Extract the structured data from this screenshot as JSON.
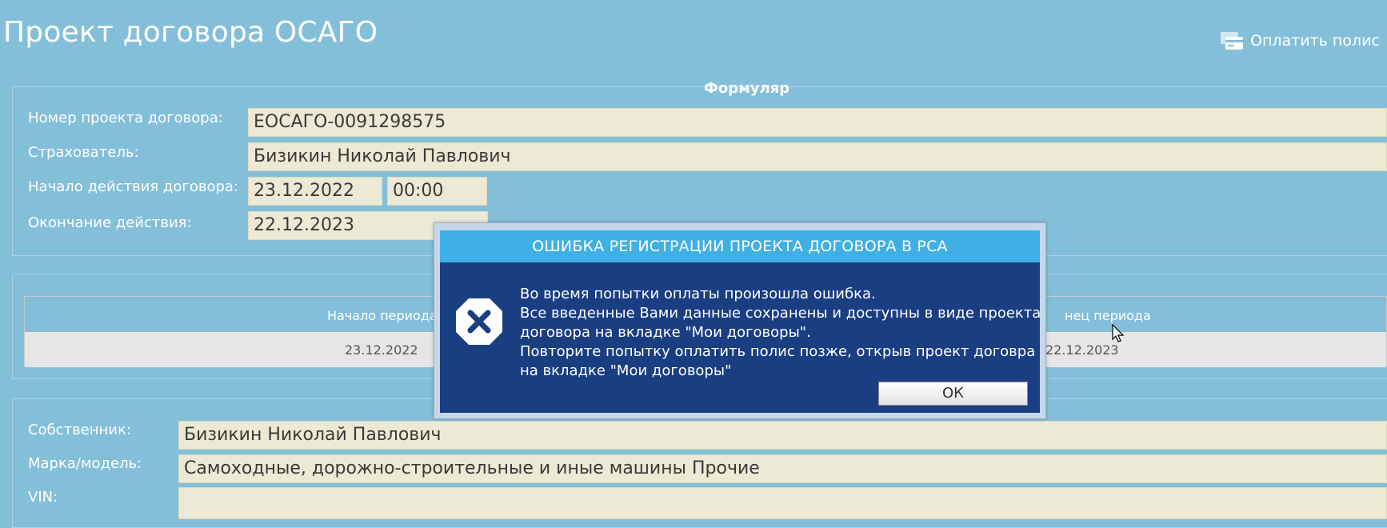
{
  "header": {
    "title": "Проект договора ОСАГО",
    "pay_link": "Оплатить полис"
  },
  "form": {
    "legend": "Формуляр",
    "contract_number_label": "Номер проекта договора:",
    "contract_number_value": "ЕОСАГО-0091298575",
    "insurer_label": "Страхователь:",
    "insurer_value": "Бизикин Николай Павлович",
    "start_label": "Начало действия договора:",
    "start_date": "23.12.2022",
    "start_time": "00:00",
    "end_label": "Окончание действия:",
    "end_date": "22.12.2023"
  },
  "periods": {
    "headers": [
      "Начало периода",
      "нец периода"
    ],
    "rows": [
      [
        "23.12.2022",
        "22.12.2023"
      ]
    ]
  },
  "vehicle": {
    "owner_label": "Собственник:",
    "owner_value": "Бизикин Николай Павлович",
    "model_label": "Марка/модель:",
    "model_value": "Самоходные, дорожно-строительные и иные машины Прочие",
    "vin_label": "VIN:",
    "vin_value": ""
  },
  "dialog": {
    "title": "ОШИБКА РЕГИСТРАЦИИ ПРОЕКТА ДОГОВОРА В РСА",
    "icon": "error-x-icon",
    "lines": [
      "Во время попытки оплаты произошла ошибка.",
      "Все введенные Вами данные сохранены и доступны в виде проекта",
      "договора на вкладке \"Мои договоры\".",
      "Повторите попытку оплатить полис позже, открыв проект договра",
      "на вкладке \"Мои договоры\""
    ],
    "ok_label": "ОК"
  },
  "colors": {
    "page_bg": "#84bfda",
    "field_bg": "#ece9d4",
    "dialog_bg": "#1a3e82",
    "dialog_title_bg": "#3fb0e6"
  }
}
